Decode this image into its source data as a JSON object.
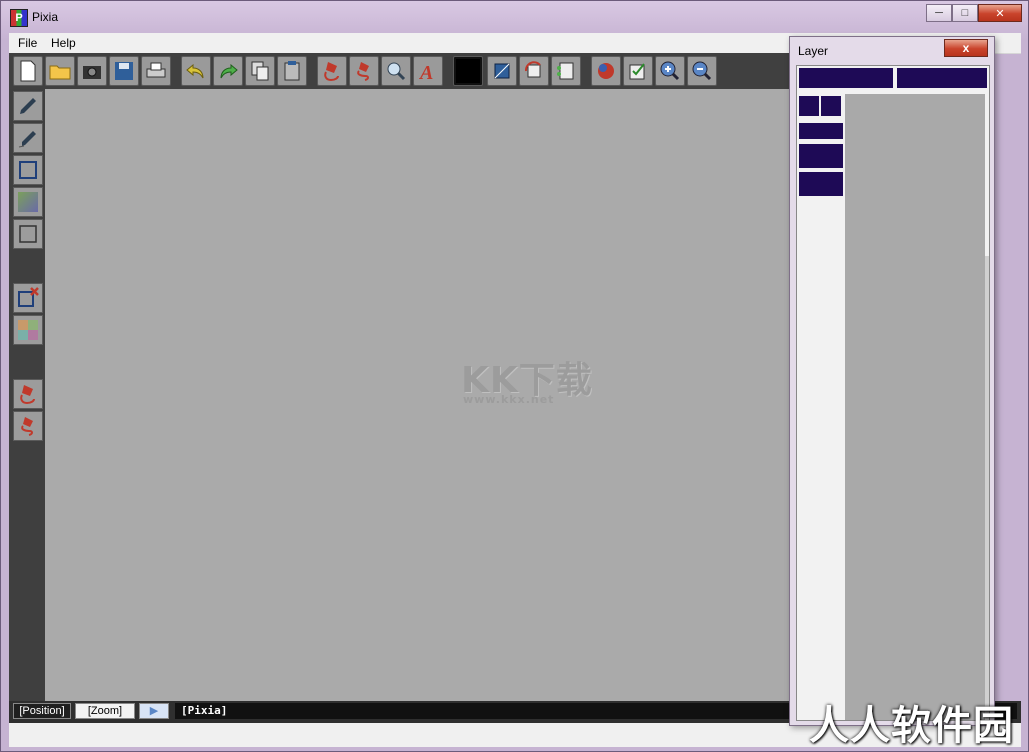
{
  "window": {
    "title": "Pixia",
    "app_icon_glyph": "P"
  },
  "menu": {
    "items": [
      "File",
      "Help"
    ]
  },
  "toolbar": {
    "icons": [
      "new-file-icon",
      "open-folder-icon",
      "camera-icon",
      "save-icon",
      "print-icon",
      "undo-icon",
      "redo-icon",
      "copy-icon",
      "paste-icon",
      "pour-ink-icon",
      "pour-ink-alt-icon",
      "magnifier-icon",
      "text-tool-icon",
      "color-swatch",
      "transform-icon",
      "rotate-icon",
      "layer-icon",
      "color-ball-icon",
      "check-edit-icon",
      "zoom-in-icon",
      "zoom-out-icon"
    ],
    "current_color": "#000000"
  },
  "tools": [
    "pen-icon",
    "pen-alt-icon",
    "rect-select-icon",
    "gradient-icon",
    "rect-icon",
    "clear-selection-icon",
    "mosaic-icon",
    "bucket-icon",
    "bucket-alt-icon"
  ],
  "status": {
    "position_label": "[Position]",
    "zoom_label": "[Zoom]",
    "text": "[Pixia]"
  },
  "layer_panel": {
    "title": "Layer",
    "close_glyph": "x"
  },
  "watermark": {
    "logo": "KK下载",
    "url": "www.kkx.net",
    "corner": "人人软件园"
  },
  "colors": {
    "canvas": "#aaaaaa",
    "layer_block": "#1e0a56",
    "toolbar_bg": "#404040"
  }
}
